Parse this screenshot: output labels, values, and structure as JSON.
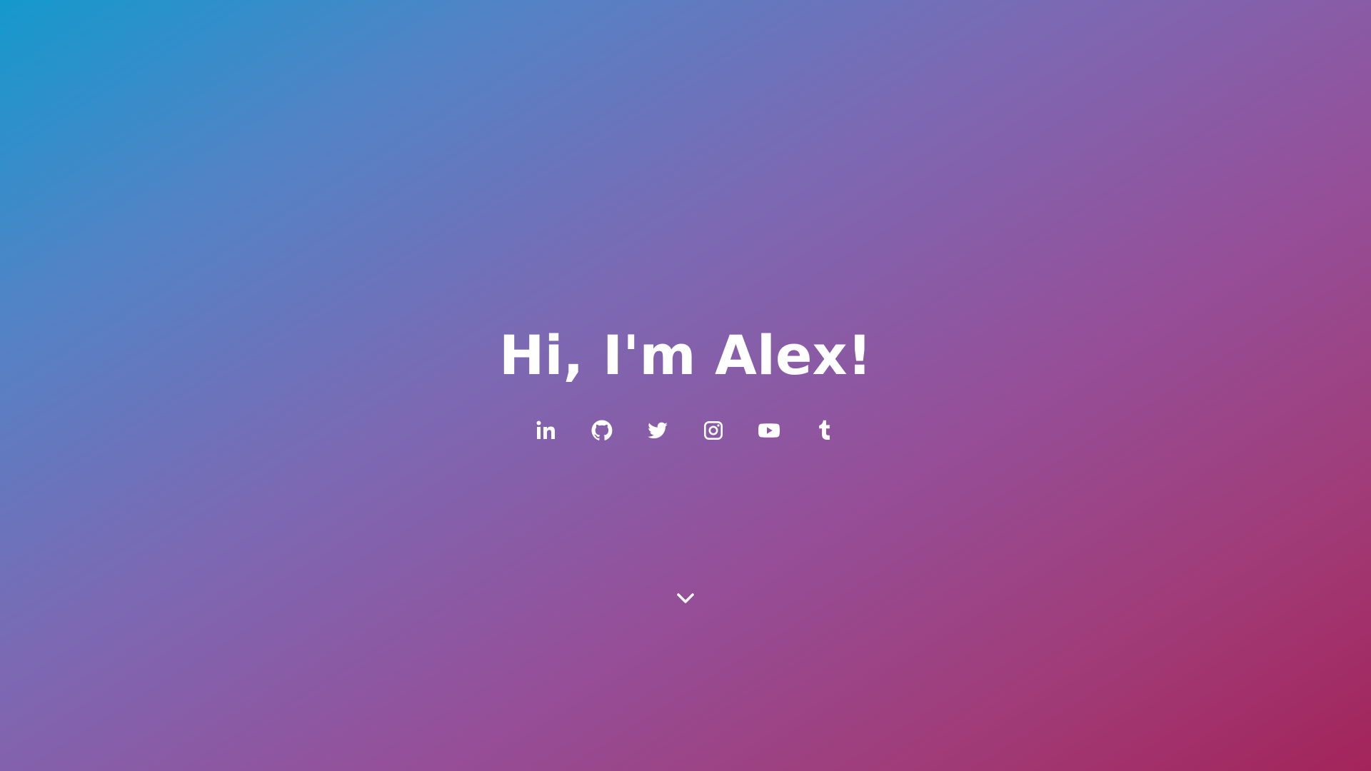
{
  "hero": {
    "title": "Hi, I'm Alex!",
    "background_colors": [
      "#1499cd",
      "#5383c6",
      "#7d68b3",
      "#94509a",
      "#a03c79",
      "#a3245a"
    ],
    "text_color": "#ffffff"
  },
  "socials": [
    {
      "name": "linkedin",
      "icon": "linkedin-icon"
    },
    {
      "name": "github",
      "icon": "github-icon"
    },
    {
      "name": "twitter",
      "icon": "twitter-icon"
    },
    {
      "name": "instagram",
      "icon": "instagram-icon"
    },
    {
      "name": "youtube",
      "icon": "youtube-icon"
    },
    {
      "name": "tumblr",
      "icon": "tumblr-icon"
    }
  ],
  "scroll": {
    "icon": "chevron-down-icon"
  }
}
